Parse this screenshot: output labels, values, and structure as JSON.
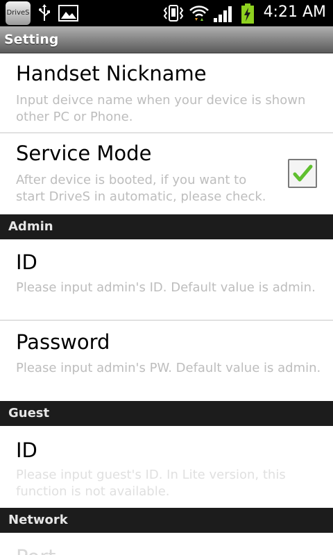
{
  "status_bar": {
    "app_icon_label": "DriveS",
    "time": "4:21 AM"
  },
  "title_bar": {
    "title": "Setting"
  },
  "prefs": {
    "nickname": {
      "title": "Handset Nickname",
      "summary": "Input deivce name when your device is shown other PC or Phone."
    },
    "service_mode": {
      "title": "Service Mode",
      "summary": "After device is booted, if you want to start DriveS in automatic, please check.",
      "checked": true
    },
    "admin_section": "Admin",
    "admin_id": {
      "title": "ID",
      "summary": "Please input admin's ID. Default value is admin."
    },
    "admin_password": {
      "title": "Password",
      "summary": "Please input admin's PW. Default value is admin."
    },
    "guest_section": "Guest",
    "guest_id": {
      "title": "ID",
      "summary": "Please input guest's ID. In Lite version, this function is not available."
    },
    "network_section": "Network",
    "port": {
      "title": "Port"
    }
  },
  "colors": {
    "checkmark": "#5fbf2f",
    "summary_text": "#bdbdbd",
    "section_bg": "#1c1c1c"
  }
}
